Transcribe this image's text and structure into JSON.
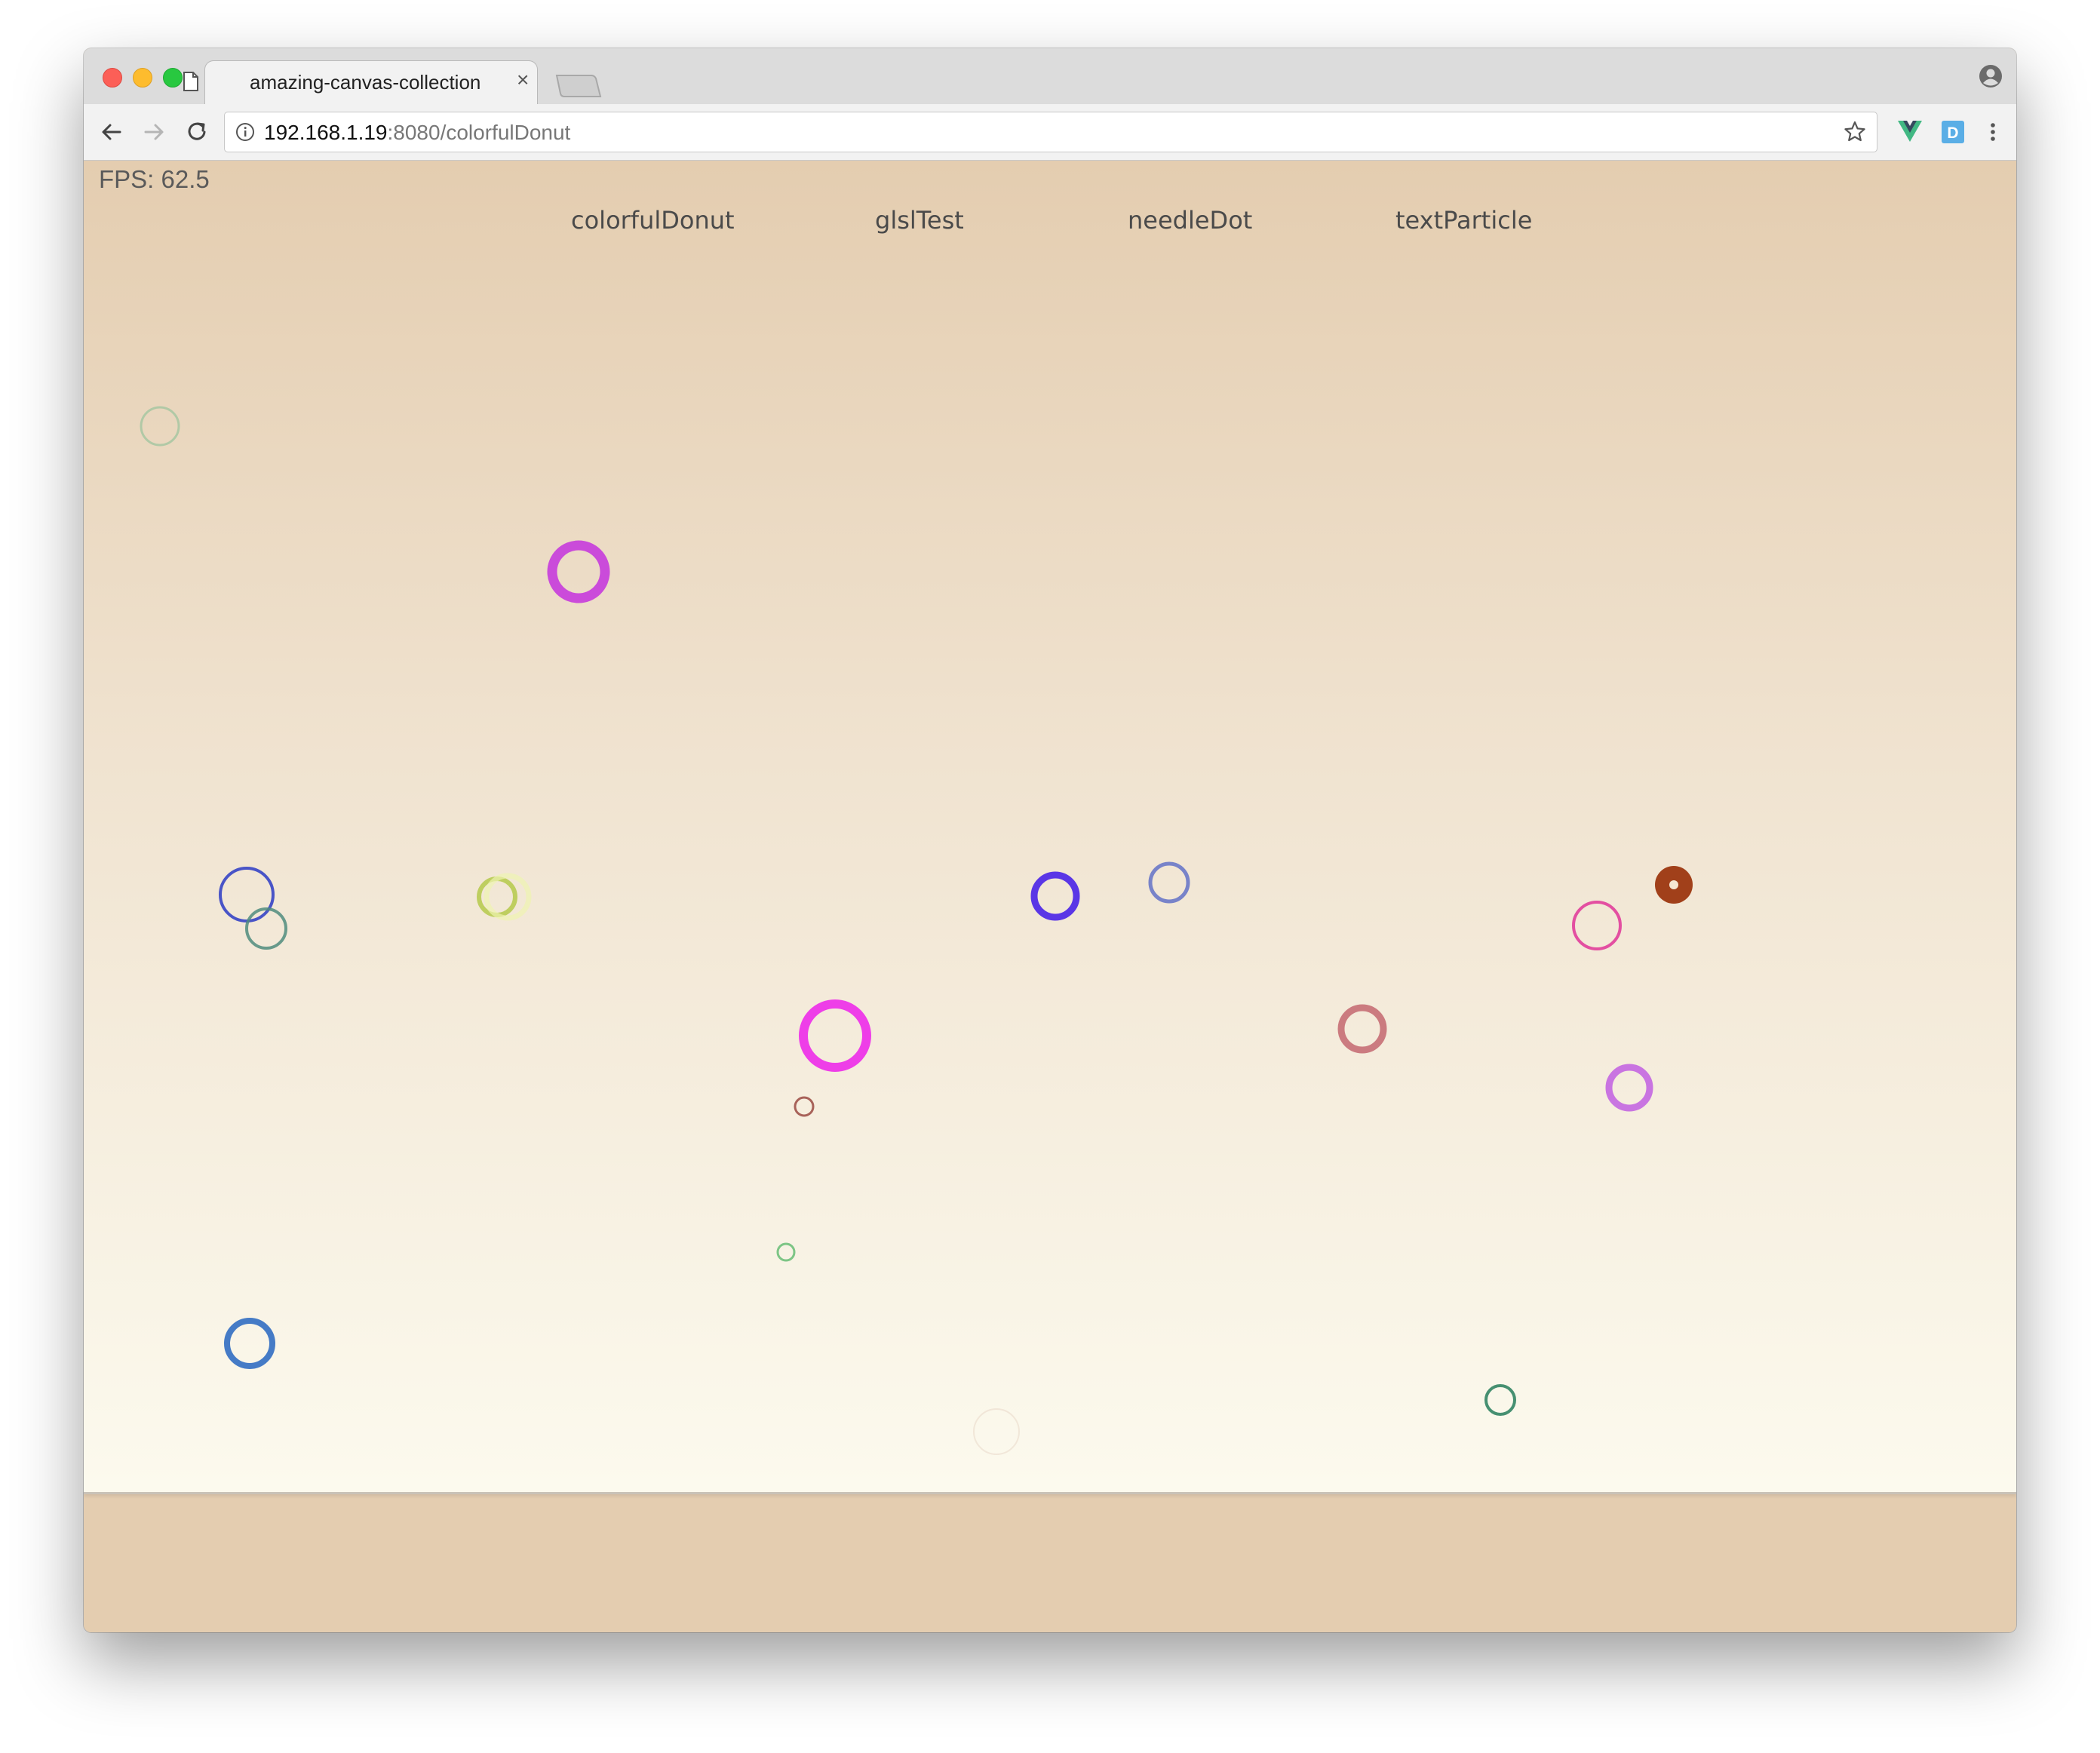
{
  "tab": {
    "title": "amazing-canvas-collection",
    "close_symbol": "×",
    "icon": "document-icon"
  },
  "address_bar": {
    "host": "192.168.1.19",
    "path": ":8080/colorfulDonut"
  },
  "extensions": [
    "vue-devtools-icon",
    "d-extension-icon"
  ],
  "page": {
    "fps_label": "FPS: 62.5",
    "nav": [
      "colorfulDonut",
      "glslTest",
      "needleDot",
      "textParticle"
    ],
    "background": {
      "top": "#e4cdb0",
      "bottom": "#fcfaee",
      "footer": "#e4cdb0"
    }
  },
  "donuts": [
    {
      "color": "#a3c6a0",
      "opacity": 0.8
    },
    {
      "color": "#c63bdc",
      "opacity": 0.9
    },
    {
      "color": "#3f4cc6",
      "opacity": 0.95
    },
    {
      "color": "#4f8c7e",
      "opacity": 0.85
    },
    {
      "color": "#b5c94a",
      "opacity": 0.85
    },
    {
      "color": "#eef3b0",
      "opacity": 0.7
    },
    {
      "color": "#ee3ee8",
      "opacity": 1
    },
    {
      "color": "#a0524a",
      "opacity": 0.9
    },
    {
      "color": "#5a36e6",
      "opacity": 1
    },
    {
      "color": "#6a78c8",
      "opacity": 0.9
    },
    {
      "color": "#e2479e",
      "opacity": 0.95
    },
    {
      "color": "#a1401a",
      "opacity": 1
    },
    {
      "color": "#c8757a",
      "opacity": 0.95
    },
    {
      "color": "#c66ee0",
      "opacity": 0.95
    },
    {
      "color": "#6fc07a",
      "opacity": 0.9
    },
    {
      "color": "#3b74c4",
      "opacity": 0.95
    },
    {
      "color": "#3c8a6a",
      "opacity": 0.95
    },
    {
      "color": "#e8d6c6",
      "opacity": 0.5
    }
  ]
}
